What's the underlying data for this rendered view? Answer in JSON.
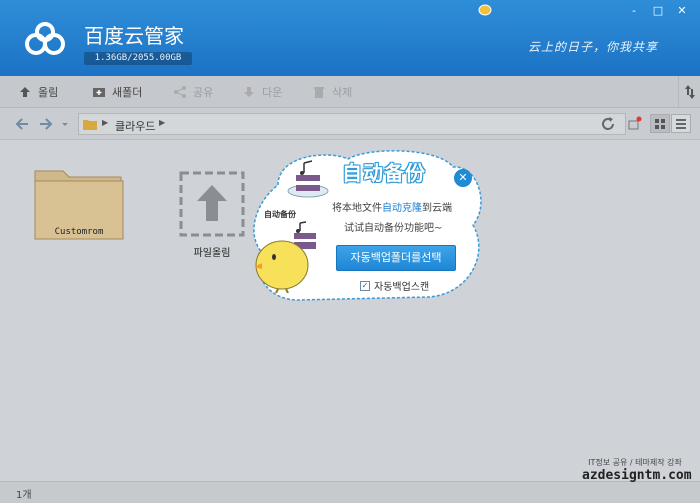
{
  "app": {
    "title": "百度云管家",
    "quota": "1.36GB/2055.00GB",
    "slogan": "云上的日子，你我共享"
  },
  "window_controls": [
    "-",
    "□",
    "✕"
  ],
  "toolbar": {
    "upload": "올림",
    "new_folder": "새폴더",
    "share": "공유",
    "download": "다운",
    "delete": "삭제"
  },
  "navbar": {
    "breadcrumb": "클라우드"
  },
  "files": [
    {
      "name": "Customrom",
      "type": "folder"
    }
  ],
  "upload_tile": {
    "label": "파일올림"
  },
  "status": {
    "count": "1개"
  },
  "popup": {
    "title": "自动备份",
    "side_label": "自动备份",
    "desc_prefix": "将本地文件",
    "desc_highlight": "自动克隆",
    "desc_suffix": "到云端",
    "desc_line2": "试试自动备份功能吧~",
    "button": "자동백업폴더를선택",
    "checkbox_label": "자동백업스캔",
    "checkbox_checked": true
  },
  "watermark": {
    "top": "IT정보 공유 / 테마제작 강좌",
    "main": "azdesigntm.com"
  },
  "colors": {
    "titlebar": "#1c72c4",
    "accent": "#1f8ad6",
    "highlight": "#1a7fd0"
  }
}
